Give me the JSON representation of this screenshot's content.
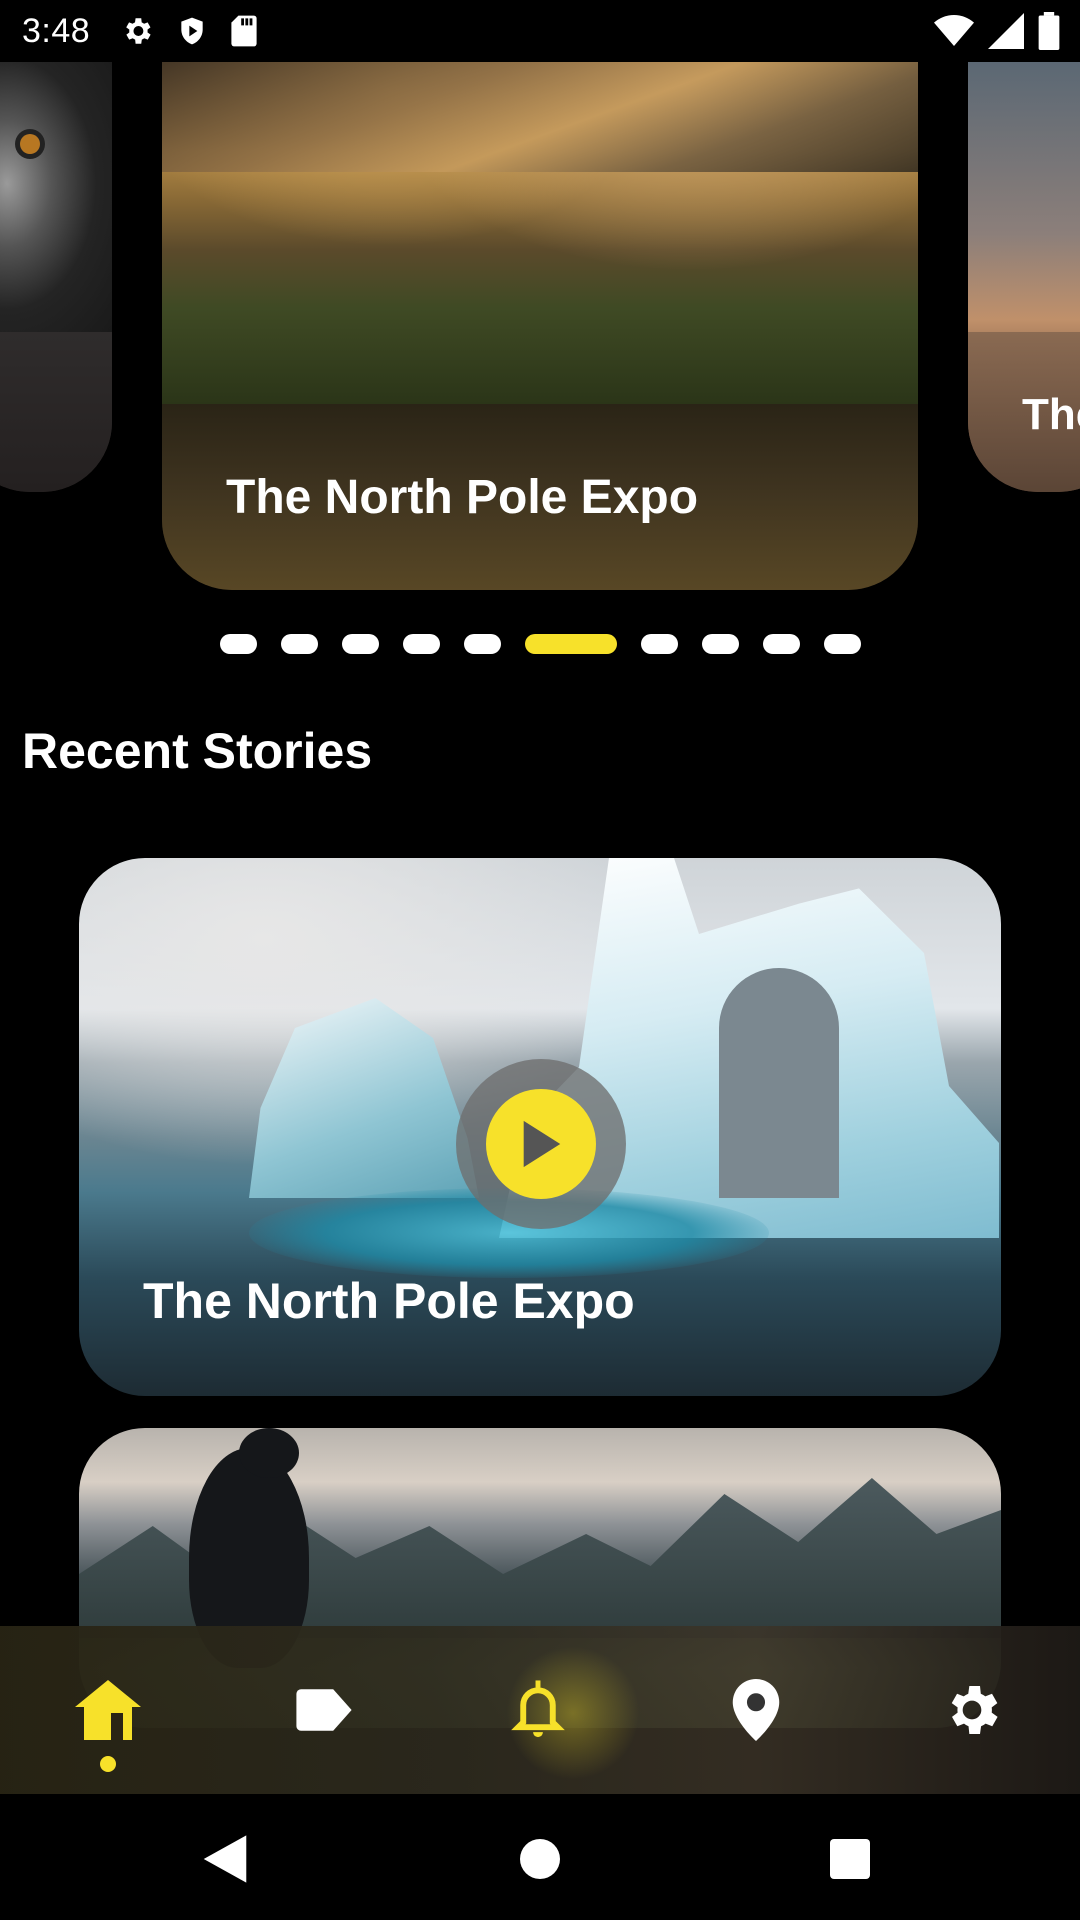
{
  "status_bar": {
    "time": "3:48",
    "left_icons": [
      "gear-icon",
      "shield-play-icon",
      "sd-card-icon"
    ],
    "right_icons": [
      "wifi-icon",
      "cell-signal-icon",
      "battery-icon"
    ]
  },
  "carousel": {
    "left_card_image": "monkey",
    "main_card": {
      "title": "The North Pole Expo",
      "image": "mountain-valley"
    },
    "right_card": {
      "title_fragment": "The",
      "image": "sunset"
    },
    "dots_count": 10,
    "active_dot_index": 5
  },
  "section_title": "Recent Stories",
  "stories": [
    {
      "title": "The North Pole Expo",
      "image": "icebergs"
    },
    {
      "title": "",
      "image": "cormorant-mountains"
    }
  ],
  "bottom_nav": [
    {
      "name": "home",
      "icon": "home-icon",
      "active": true
    },
    {
      "name": "tag",
      "icon": "tag-icon",
      "active": false
    },
    {
      "name": "notifications",
      "icon": "bell-icon",
      "active": false
    },
    {
      "name": "location",
      "icon": "location-pin-icon",
      "active": false
    },
    {
      "name": "settings",
      "icon": "gear-icon",
      "active": false
    }
  ],
  "colors": {
    "accent": "#f7e12a",
    "background": "#000000",
    "text": "#ffffff"
  }
}
